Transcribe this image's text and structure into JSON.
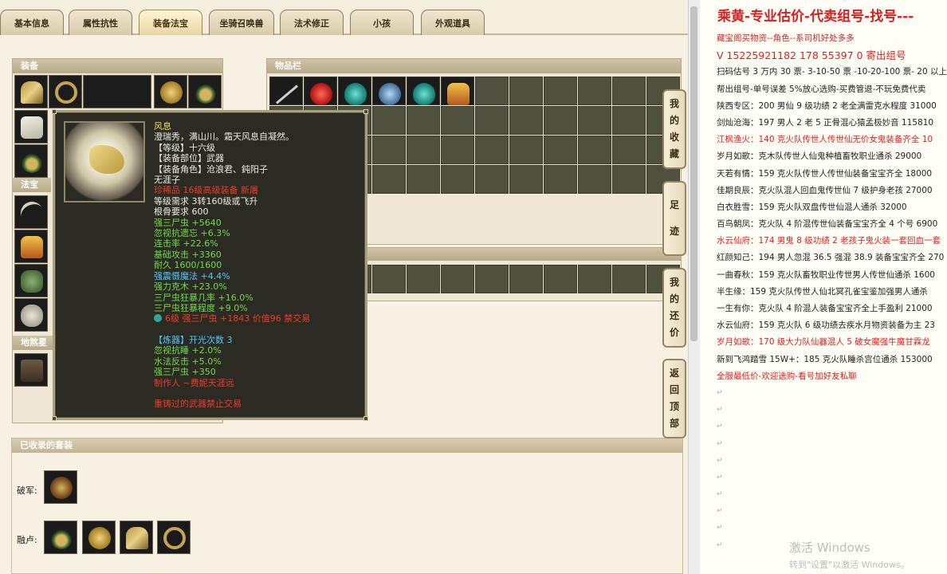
{
  "tabs": [
    "基本信息",
    "属性抗性",
    "装备法宝",
    "坐骑召唤兽",
    "法术修正",
    "小孩",
    "外观道具"
  ],
  "active_tab": "装备法宝",
  "panels": {
    "equipment": "装备",
    "artifact": "法宝",
    "formation": "地煞星",
    "inventory": "物品栏",
    "sets": "已收录的套装"
  },
  "sets": {
    "row1_label": "破军:",
    "row2_label": "融卢:"
  },
  "tooltip": {
    "lines": [
      {
        "text": "风息",
        "color": "yellow"
      },
      {
        "text": "澄瑞秀，满山川。霜天风息自凝然。",
        "color": "white"
      },
      {
        "text": "【等级】十六级",
        "color": "white"
      },
      {
        "text": "【装备部位】武器",
        "color": "white"
      },
      {
        "text": "【装备角色】沧浪君、鈍阳子",
        "color": "white"
      },
      {
        "text": "无涯子",
        "color": "white"
      },
      {
        "text": "珍稀品 16级高级装备 新屠",
        "color": "red"
      },
      {
        "text": "等级需求 3转160级或飞升",
        "color": "white"
      },
      {
        "text": "根骨要求 600",
        "color": "white"
      },
      {
        "text": "强三尸虫 +5640",
        "color": "green"
      },
      {
        "text": "忽视抗遗忘 +6.3%",
        "color": "green"
      },
      {
        "text": "连击率 +22.6%",
        "color": "green"
      },
      {
        "text": "基础攻击 +3360",
        "color": "green"
      },
      {
        "text": "耐久 1600/1600",
        "color": "green"
      },
      {
        "text": "强震慑魔法 +4.4%",
        "color": "cyan"
      },
      {
        "text": "强力克木 +23.0%",
        "color": "green"
      },
      {
        "text": "三尸虫狂暴几率 +16.0%",
        "color": "green"
      },
      {
        "text": "三尸虫狂暴程度 +9.0%",
        "color": "green"
      },
      {
        "text": "6级 强三尸虫 +1843 价值96 禁交易",
        "color": "red"
      }
    ],
    "lower_lines": [
      {
        "text": "【炼器】开光次数 3",
        "color": "cyan"
      },
      {
        "text": "忽视抗睡 +2.0%",
        "color": "green"
      },
      {
        "text": "水法反击 +5.0%",
        "color": "green"
      },
      {
        "text": "强三尸虫 +350",
        "color": "green"
      },
      {
        "text": "制作人 ~费妮天涯远",
        "color": "red"
      }
    ],
    "footer": "重铸过的武器禁止交易"
  },
  "side_nav": [
    {
      "label": "我的收藏",
      "chars": [
        "我",
        "的",
        "收",
        "藏"
      ]
    },
    {
      "label": "足迹",
      "chars": [
        "足",
        "迹"
      ]
    },
    {
      "label": "我的还价",
      "chars": [
        "我",
        "的",
        "还",
        "价"
      ]
    },
    {
      "label": "返回顶部",
      "chars": [
        "返",
        "回",
        "顶",
        "部"
      ]
    }
  ],
  "doc": {
    "title": "乘黄-专业估价-代卖组号-找号---",
    "lines": [
      {
        "text": "藏宝阁买物资--角色--系司机好处多多",
        "style": "red"
      },
      {
        "text": "V 15225921182   178 55397 0 寄出组号",
        "style": "red big"
      },
      {
        "text": "扫码估号 3 万内 30 票- 3-10-50 票  -10-20-100 票- 20 以上",
        "style": ""
      },
      {
        "text": "帮出组号-单号误差 5%放心选购-买费管退-不玩免费代卖",
        "style": ""
      },
      {
        "text": "陕西专区：200 男仙 9 级功绩 2 老全满雷克水程度 31000",
        "style": ""
      },
      {
        "text": "剑灿沧海：197 男人 2 老 5 正骨混心猿孟极妙音 115810",
        "style": ""
      },
      {
        "text": "江枫渔火：140 克火队传世人传世仙无价女鬼装备齐全 10",
        "style": "red"
      },
      {
        "text": "岁月如歌：克木队传世人仙鬼种植畜牧职业通杀 29000",
        "style": ""
      },
      {
        "text": "天若有情：159 克火队传世人传世仙装备宝宝齐全 18000",
        "style": ""
      },
      {
        "text": "佳期良辰：克火队混人回血鬼传世仙 7 级护身老孩 27000",
        "style": ""
      },
      {
        "text": "白衣胜雪：159 克火队双盘传世仙混人通杀 32000",
        "style": ""
      },
      {
        "text": "百鸟朝凤：克火队 4 阶混传世仙装备宝宝齐全 4 个号 6900",
        "style": ""
      },
      {
        "text": "水云仙府：174 男鬼 8 级功绩 2 老孩子鬼火装一套回血一套",
        "style": "red"
      },
      {
        "text": "红颜知己：194 男人忽混 36.5 强混 38.9 装备宝宝齐全 270",
        "style": ""
      },
      {
        "text": "一曲春秋：159 克火队畜牧职业传世男人传世仙通杀 1600",
        "style": ""
      },
      {
        "text": "半生缘：159 克火队传世人仙北冥孔雀宝鉴加强男人通杀",
        "style": ""
      },
      {
        "text": "一生有你：克火队 4 阶混人装备宝宝齐全上手盈利 21000",
        "style": ""
      },
      {
        "text": "水云仙府：159 克火队 6 级功绩去疾水月物资装备为主 23",
        "style": ""
      },
      {
        "text": "岁月如歌：170 级大力队仙器混人 5 破女魔强牛魔甘霖龙",
        "style": "red"
      },
      {
        "text": "新到飞鸿踏雪 15W+：185 克火队睡杀宫位通杀 153000",
        "style": ""
      },
      {
        "text": "全服最低价-欢迎选购-看号加好友私聊",
        "style": "red"
      }
    ],
    "empty_mark": "↵",
    "watermark": {
      "line1": "激活 Windows",
      "line2": "转到\"设置\"以激活 Windows。"
    }
  }
}
